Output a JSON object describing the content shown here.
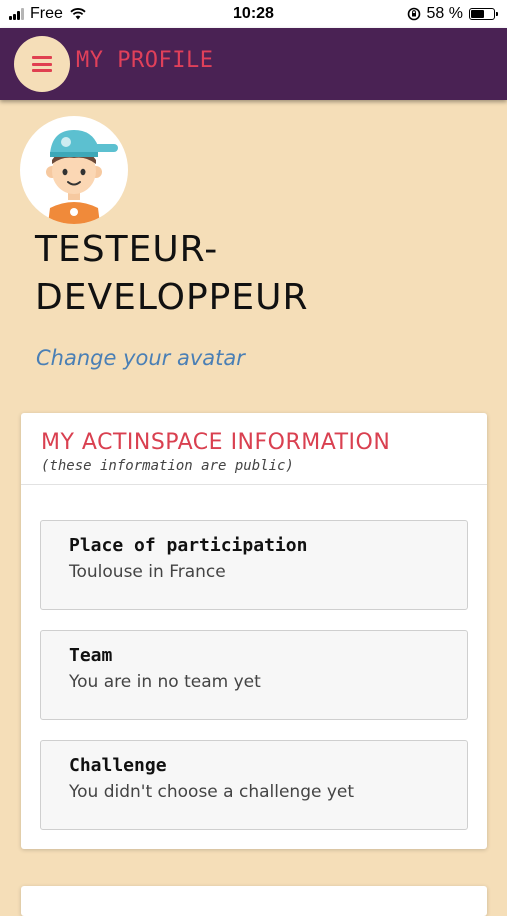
{
  "status_bar": {
    "carrier": "Free",
    "time": "10:28",
    "battery_percent": "58 %",
    "battery_level": 0.58
  },
  "app_bar": {
    "title": "MY PROFILE",
    "menu_icon": "hamburger-menu-icon"
  },
  "profile": {
    "username": "TESTEUR-DEVELOPPEUR",
    "change_avatar_link": "Change your avatar"
  },
  "info_card": {
    "title": "MY ACTINSPACE INFORMATION",
    "subtitle": "(these information are public)",
    "items": [
      {
        "label": "Place of participation",
        "value": "Toulouse in France"
      },
      {
        "label": "Team",
        "value": "You are in no team yet"
      },
      {
        "label": "Challenge",
        "value": "You didn't choose a challenge yet"
      }
    ]
  },
  "colors": {
    "background": "#f5deb8",
    "app_bar": "#4a2254",
    "accent": "#e0405a",
    "link": "#4a7fb5"
  }
}
